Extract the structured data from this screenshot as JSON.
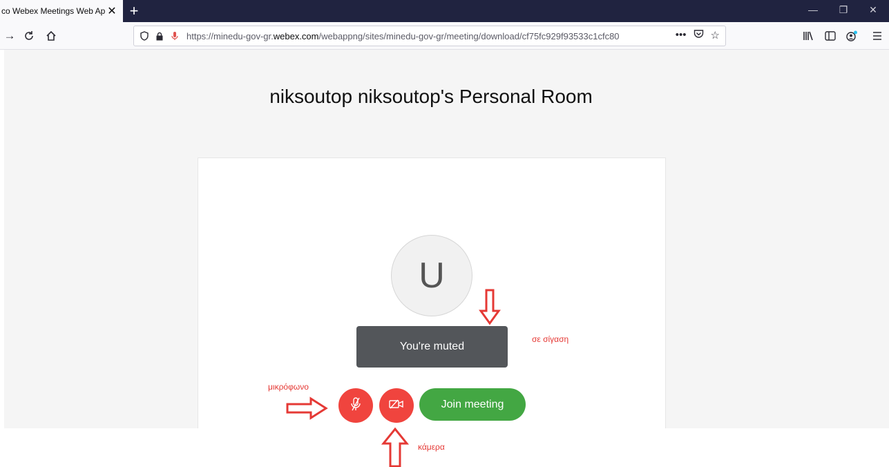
{
  "browser": {
    "tab_title": "co Webex Meetings Web Ap",
    "url_prefix": "https://minedu-gov-gr.",
    "url_domain": "webex.com",
    "url_path": "/webappng/sites/minedu-gov-gr/meeting/download/cf75fc929f93533c1cfc80",
    "icons": {
      "back": "arrow-right-icon",
      "reload": "reload-icon",
      "home": "home-icon",
      "shield": "shield-icon",
      "lock": "lock-icon",
      "mic": "microphone-icon",
      "more": "more-icon",
      "pocket": "pocket-icon",
      "star": "star-icon",
      "library": "library-icon",
      "sidebar": "sidebar-icon",
      "account": "account-icon",
      "menu": "menu-icon"
    }
  },
  "meeting": {
    "room_title": "niksoutop niksoutop's Personal Room",
    "avatar_initial": "U",
    "tooltip": "You're muted",
    "join_label": "Join meeting"
  },
  "annotations": {
    "muted": "σε σίγαση",
    "microphone": "μικρόφωνο",
    "camera": "κάμερα"
  },
  "colors": {
    "mute_button": "#f0443e",
    "join_button": "#43a743",
    "annotation": "#e53935"
  }
}
